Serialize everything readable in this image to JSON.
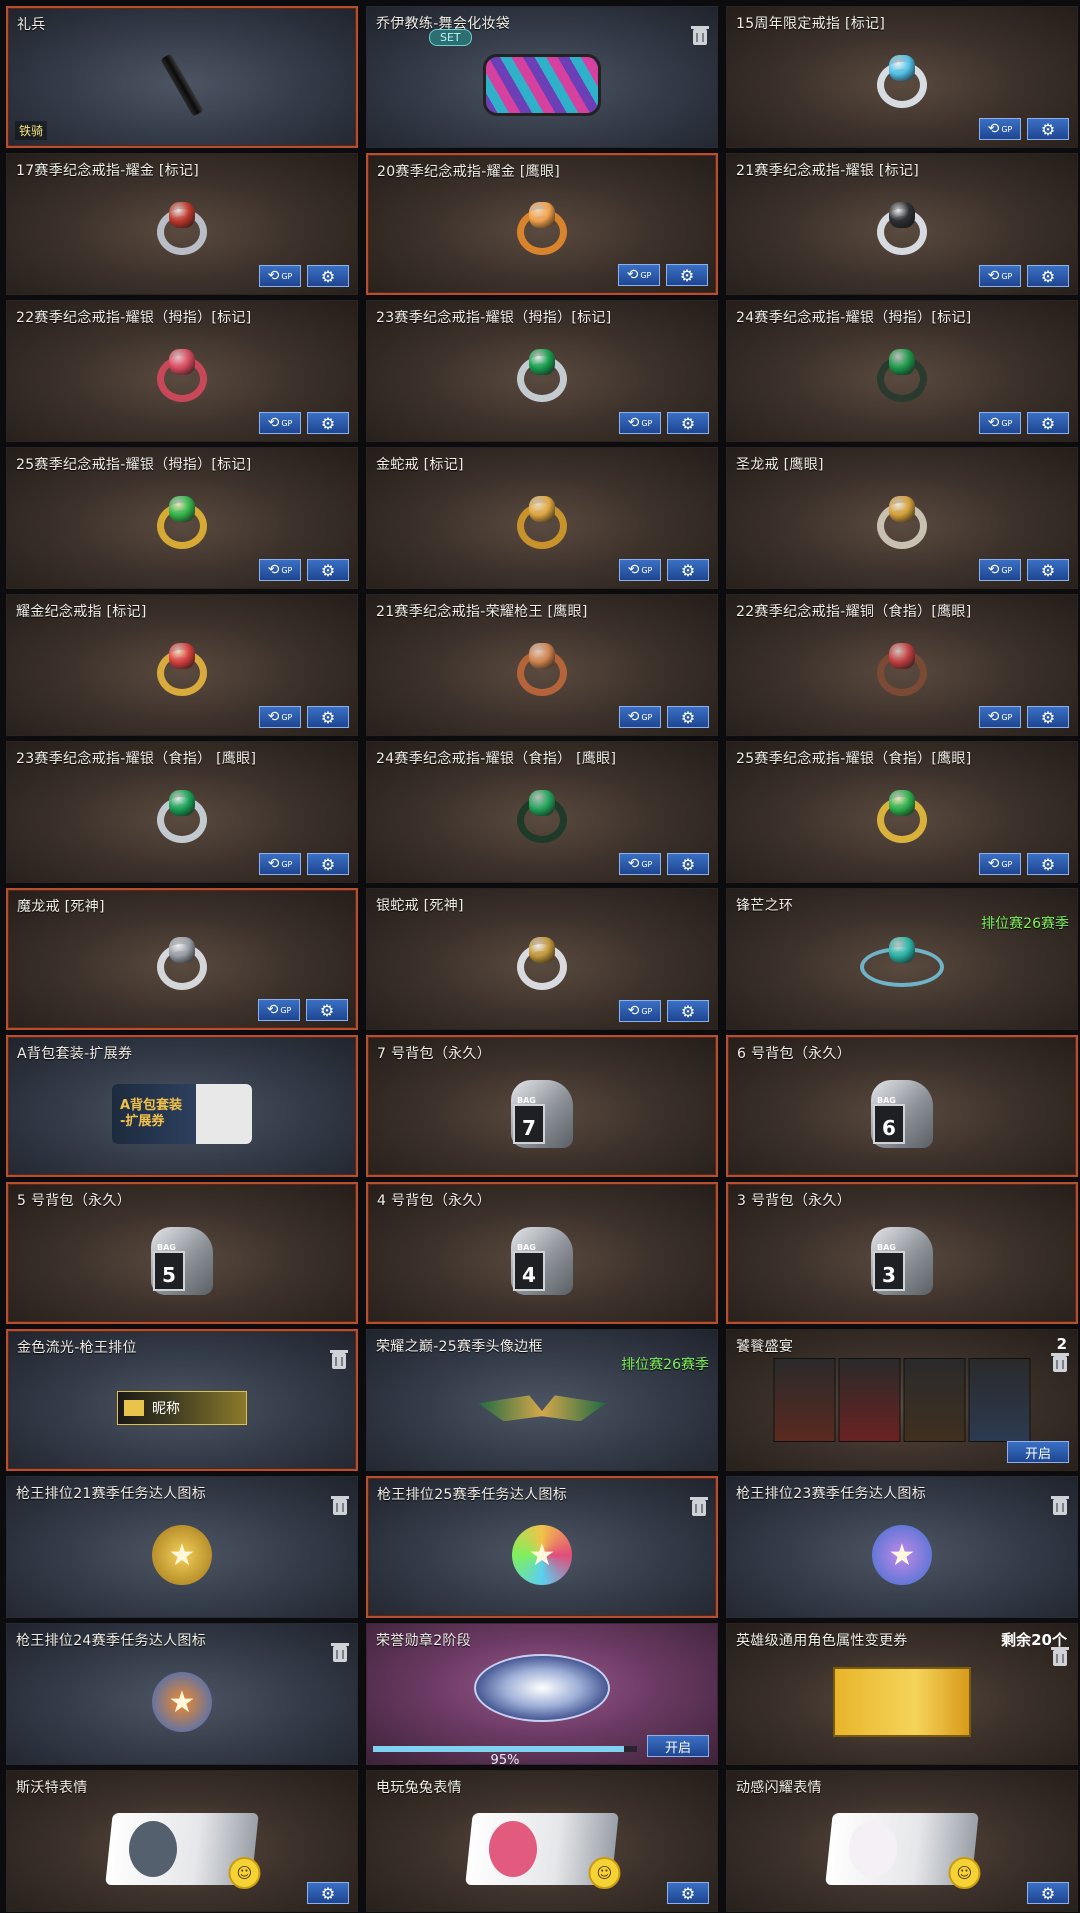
{
  "cards": [
    {
      "title": "礼兵",
      "theme": "blue",
      "selected": true,
      "art": "rifle-suppressor",
      "badge": "铁骑"
    },
    {
      "title": "乔伊教练-舞会化妆袋",
      "theme": "blue",
      "art": "cosmetic-bag",
      "set_tag": "SET",
      "trash": true
    },
    {
      "title": "15周年限定戒指 [标记]",
      "art": "star-ring",
      "buttons": [
        "gp",
        "gear"
      ]
    },
    {
      "title": "17赛季纪念戒指-耀金 [标记]",
      "art": "ring-gold-red",
      "buttons": [
        "gp",
        "gear"
      ]
    },
    {
      "title": "20赛季纪念戒指-耀金 [鹰眼]",
      "selected": true,
      "art": "ring-gold-dragon",
      "buttons": [
        "gp",
        "gear"
      ]
    },
    {
      "title": "21赛季纪念戒指-耀银 [标记]",
      "art": "ring-silver-tiger",
      "buttons": [
        "gp",
        "gear"
      ]
    },
    {
      "title": "22赛季纪念戒指-耀银（拇指）[标记]",
      "art": "ring-red-scaled",
      "buttons": [
        "gp",
        "gear"
      ]
    },
    {
      "title": "23赛季纪念戒指-耀银（拇指）[标记]",
      "art": "ring-silver-green",
      "buttons": [
        "gp",
        "gear"
      ]
    },
    {
      "title": "24赛季纪念戒指-耀银（拇指）[标记]",
      "art": "ring-dark-green",
      "buttons": [
        "gp",
        "gear"
      ]
    },
    {
      "title": "25赛季纪念戒指-耀银（拇指）[标记]",
      "art": "ring-gold-green",
      "buttons": [
        "gp",
        "gear"
      ]
    },
    {
      "title": "金蛇戒 [标记]",
      "art": "ring-gold-snake",
      "buttons": [
        "gp",
        "gear"
      ]
    },
    {
      "title": "圣龙戒 [鹰眼]",
      "art": "ring-holy-dragon",
      "buttons": [
        "gp",
        "gear"
      ]
    },
    {
      "title": "耀金纪念戒指 [标记]",
      "art": "ring-gold-ruby",
      "buttons": [
        "gp",
        "gear"
      ]
    },
    {
      "title": "21赛季纪念戒指-荣耀枪王 [鹰眼]",
      "art": "ring-bronze-tiger",
      "buttons": [
        "gp",
        "gear"
      ]
    },
    {
      "title": "22赛季纪念戒指-耀铜（食指）[鹰眼]",
      "art": "ring-bronze-ornate",
      "buttons": [
        "gp",
        "gear"
      ]
    },
    {
      "title": "23赛季纪念戒指-耀银（食指） [鹰眼]",
      "art": "ring-silver-emerald",
      "buttons": [
        "gp",
        "gear"
      ]
    },
    {
      "title": "24赛季纪念戒指-耀银（食指） [鹰眼]",
      "art": "ring-green-dark",
      "buttons": [
        "gp",
        "gear"
      ]
    },
    {
      "title": "25赛季纪念戒指-耀银（食指）[鹰眼]",
      "art": "ring-gold-emerald",
      "buttons": [
        "gp",
        "gear"
      ]
    },
    {
      "title": "魔龙戒 [死神]",
      "selected": true,
      "art": "ring-demon-dragon",
      "buttons": [
        "gp",
        "gear"
      ]
    },
    {
      "title": "银蛇戒 [死神]",
      "art": "ring-silver-snake",
      "buttons": [
        "gp",
        "gear"
      ]
    },
    {
      "title": "锋芒之环",
      "art": "ring-blue-band",
      "green": "排位赛26赛季"
    },
    {
      "title": "A背包套装-扩展券",
      "theme": "blue",
      "selected": true,
      "art": "bag-expansion-ticket",
      "art_text": "A背包套装\n-扩展券"
    },
    {
      "title": "7 号背包（永久）",
      "selected": true,
      "art": "bag",
      "bag_number": "7"
    },
    {
      "title": "6 号背包（永久）",
      "selected": true,
      "art": "bag",
      "bag_number": "6"
    },
    {
      "title": "5 号背包（永久）",
      "selected": true,
      "art": "bag",
      "bag_number": "5"
    },
    {
      "title": "4 号背包（永久）",
      "selected": true,
      "art": "bag",
      "bag_number": "4"
    },
    {
      "title": "3 号背包（永久）",
      "selected": true,
      "art": "bag",
      "bag_number": "3"
    },
    {
      "title": "金色流光-枪王排位",
      "theme": "blue",
      "selected": true,
      "art": "nickname-plate",
      "art_text": "昵称",
      "trash": true
    },
    {
      "title": "荣耀之巅-25赛季头像边框",
      "theme": "blue",
      "art": "avatar-frame",
      "green": "排位赛26赛季"
    },
    {
      "title": "饕餮盛宴",
      "art": "character-cards",
      "count": "2",
      "trash": true,
      "open_label": "开启"
    },
    {
      "title": "枪王排位21赛季任务达人图标",
      "theme": "blue",
      "art": "trophy-gold",
      "trash": true
    },
    {
      "title": "枪王排位25赛季任务达人图标",
      "theme": "blue",
      "selected": true,
      "art": "trophy-rainbow",
      "trash": true
    },
    {
      "title": "枪王排位23赛季任务达人图标",
      "theme": "blue",
      "art": "trophy-blue-pink",
      "trash": true
    },
    {
      "title": "枪王排位24赛季任务达人图标",
      "theme": "blue",
      "art": "trophy-fire",
      "trash": true
    },
    {
      "title": "荣誉勋章2阶段",
      "theme": "purple",
      "art": "medal-emblem",
      "progress": 0.95,
      "progress_label": "95%",
      "open_label": "开启"
    },
    {
      "title": "英雄级通用角色属性变更券",
      "art": "character-ticket",
      "remain": "剩余20个",
      "trash": true
    },
    {
      "title": "斯沃特表情",
      "art": "emote-swat",
      "buttons": [
        "gear"
      ]
    },
    {
      "title": "电玩兔兔表情",
      "art": "emote-bunny",
      "buttons": [
        "gear"
      ]
    },
    {
      "title": "动感闪耀表情",
      "art": "emote-shine",
      "buttons": [
        "gear"
      ]
    }
  ],
  "gp_label": "GP",
  "colors": {
    "accent": "#b4502e",
    "green_text": "#7ff05b",
    "button": "#2b5db1"
  }
}
